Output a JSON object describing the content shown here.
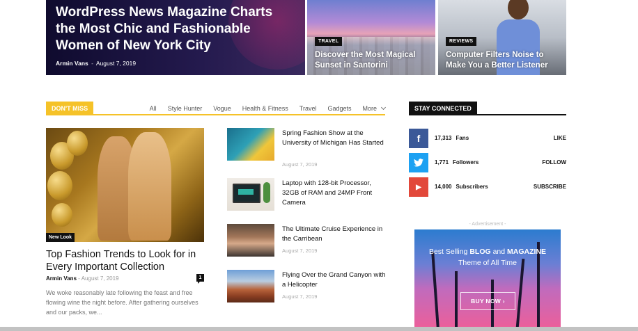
{
  "hero": {
    "main": {
      "title": "WordPress News Magazine Charts the Most Chic and Fashionable Women of New York City",
      "author": "Armin Vans",
      "separator": "-",
      "date": "August 7, 2019"
    },
    "cards": [
      {
        "category": "TRAVEL",
        "title": "Discover the Most Magical Sunset in Santorini"
      },
      {
        "category": "REVIEWS",
        "title": "Computer Filters Noise to Make You a Better Listener"
      }
    ]
  },
  "dont_miss": {
    "label": "DON'T MISS",
    "tabs": [
      "All",
      "Style Hunter",
      "Vogue",
      "Health & Fitness",
      "Travel",
      "Gadgets"
    ],
    "more_label": "More",
    "feature": {
      "badge": "New Look",
      "title": "Top Fashion Trends to Look for in Every Important Collection",
      "author": "Armin Vans",
      "separator": "-",
      "date": "August 7, 2019",
      "comments": "1",
      "excerpt": "We woke reasonably late following the feast and free flowing wine the night before. After gathering ourselves and our packs, we..."
    },
    "list": [
      {
        "title": "Spring Fashion Show at the University of Michigan Has Started",
        "date": "August 7, 2019"
      },
      {
        "title": "Laptop with 128-bit Processor, 32GB of RAM and 24MP Front Camera",
        "date": "August 7, 2019"
      },
      {
        "title": "The Ultimate Cruise Experience in the Carribean",
        "date": "August 7, 2019"
      },
      {
        "title": "Flying Over the Grand Canyon with a Helicopter",
        "date": "August 7, 2019"
      }
    ]
  },
  "stay_connected": {
    "label": "STAY CONNECTED",
    "networks": [
      {
        "icon": "facebook-icon",
        "glyph": "f",
        "color": "#3b5998",
        "count": "17,313",
        "unit": "Fans",
        "action": "LIKE"
      },
      {
        "icon": "twitter-icon",
        "glyph": "t",
        "color": "#1da1f2",
        "count": "1,771",
        "unit": "Followers",
        "action": "FOLLOW"
      },
      {
        "icon": "youtube-icon",
        "glyph": "▶",
        "color": "#e2483a",
        "count": "14,000",
        "unit": "Subscribers",
        "action": "SUBSCRIBE"
      }
    ]
  },
  "advertisement": {
    "label": "- Advertisement -",
    "line1_a": "Best Selling ",
    "line1_b": "BLOG",
    "line1_c": " and ",
    "line1_d": "MAGAZINE",
    "line2": "Theme of All Time",
    "button": "BUY NOW  ›"
  },
  "colors": {
    "accent": "#f5c228",
    "dark": "#111111"
  }
}
